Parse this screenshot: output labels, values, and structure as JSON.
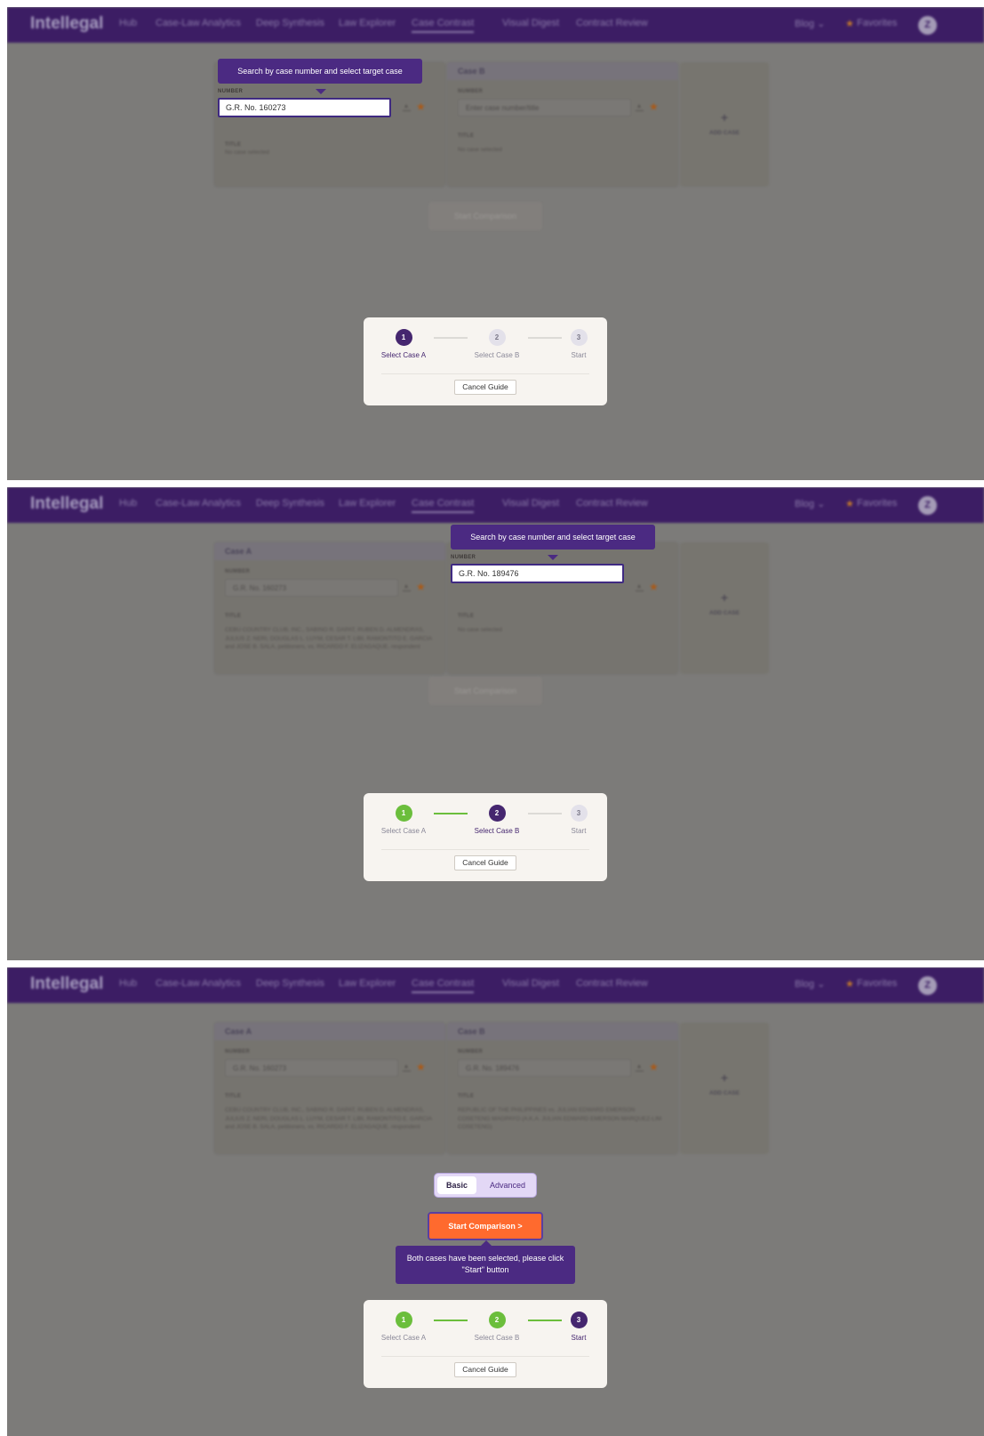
{
  "nav": {
    "logo": "Intellegal",
    "items": [
      "Hub",
      "Case-Law Analytics",
      "Deep Synthesis",
      "Law Explorer",
      "Case Contrast",
      "Visual Digest",
      "Contract Review"
    ],
    "blog": "Blog ⌄",
    "favorites": "Favorites",
    "avatar": "Z"
  },
  "card_a": {
    "heading": "Case A",
    "number_label": "NUMBER",
    "title_label": "TITLE",
    "number_value": "G.R. No. 160273",
    "title_value": "CEBU COUNTRY CLUB, INC., SABINO R. DAPAT, RUBEN D. ALMENDRAS, JULIUS Z. NERI, DOUGLAS L. LUYM, CESAR T. LIBI, RAMONTITO E. GARCIA and JOSE B. SALA, petitioners, vs. RICARDO F. ELIZAGAQUE, respondent",
    "empty_title": "No case selected"
  },
  "card_b": {
    "heading": "Case B",
    "number_label": "NUMBER",
    "title_label": "TITLE",
    "placeholder": "Enter case number/title",
    "number_value": "G.R. No. 189476",
    "title_value": "REPUBLIC OF THE PHILIPPINES vs. JULIAN EDWARD EMERSON COSETENG MAGPAYO (A.K.A. JULIAN EDWARD EMERSON MARQUEZ-LIM COSETENG)",
    "empty_title": "No case selected"
  },
  "add_case": {
    "plus": "+",
    "label": "ADD CASE"
  },
  "start_button": "Start Comparison",
  "start_button_active": "Start Comparison >",
  "mode": {
    "basic": "Basic",
    "advanced": "Advanced"
  },
  "tooltips": {
    "search": "Search by case number and select target case",
    "start": "Both cases have been selected, please click \"Start\" button"
  },
  "guide": {
    "steps": [
      {
        "number": "1",
        "label": "Select Case A"
      },
      {
        "number": "2",
        "label": "Select Case B"
      },
      {
        "number": "3",
        "label": "Start"
      }
    ],
    "cancel": "Cancel Guide"
  },
  "colors": {
    "brand": "#3c1d64",
    "accent_orange": "#ff6a2e",
    "done_green": "#6bbe3c",
    "tooltip_purple": "#4b2a82"
  }
}
